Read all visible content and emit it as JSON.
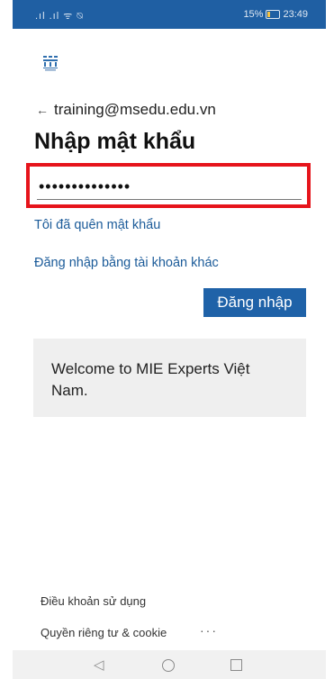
{
  "statusbar": {
    "signal": ".ıl .ıl ᯤ ⍉",
    "battery_percent": "15%",
    "time": "23:49"
  },
  "account": {
    "email": "training@msedu.edu.vn"
  },
  "page_title": "Nhập mật khẩu",
  "password": {
    "value": "••••••••••••••"
  },
  "links": {
    "forgot": "Tôi đã quên mật khẩu",
    "other_account": "Đăng nhập bằng tài khoản khác"
  },
  "signin_button": "Đăng nhập",
  "welcome_text": "Welcome to MIE Experts Việt Nam.",
  "footer": {
    "terms": "Điều khoản sử dụng",
    "privacy": "Quyền riêng tư & cookie",
    "more": "···"
  },
  "colors": {
    "statusbar": "#1f5fa3",
    "accent": "#1f62a8",
    "highlight": "#e6141b"
  }
}
